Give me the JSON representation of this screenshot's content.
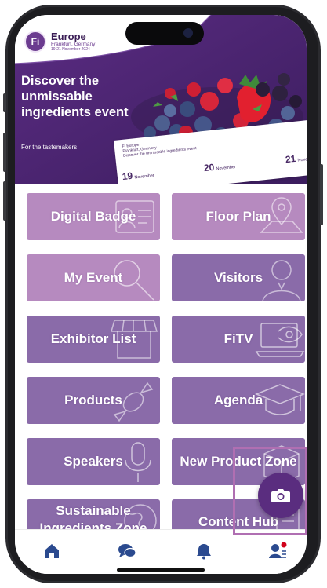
{
  "app": {
    "brand": {
      "logo_text": "Fi",
      "name": "Europe",
      "location": "Frankfurt, Germany",
      "dates": "19-21 November 2024"
    },
    "hero": {
      "headline": "Discover the unmissable ingredients event",
      "tagline": "For the tastemakers",
      "card": {
        "line1": "Fi Europe",
        "line2": "Frankfurt, Germany",
        "line3": "Discover the unmissable ingredients event"
      },
      "dates": [
        {
          "day": "19",
          "month": "November"
        },
        {
          "day": "20",
          "month": "November"
        },
        {
          "day": "21",
          "month": "November"
        }
      ]
    },
    "tiles": [
      {
        "label": "Digital Badge",
        "icon": "id-badge-icon"
      },
      {
        "label": "Floor Plan",
        "icon": "map-pin-icon"
      },
      {
        "label": "My Event",
        "icon": "magnifier-icon"
      },
      {
        "label": "Visitors",
        "icon": "person-icon"
      },
      {
        "label": "Exhibitor List",
        "icon": "storefront-icon"
      },
      {
        "label": "FiTV",
        "icon": "laptop-eye-icon"
      },
      {
        "label": "Products",
        "icon": "candy-icon"
      },
      {
        "label": "Agenda",
        "icon": "graduation-cap-icon"
      },
      {
        "label": "Speakers",
        "icon": "microphone-icon"
      },
      {
        "label": "New Product Zone",
        "icon": "box-icon"
      },
      {
        "label": "Sustainable Ingredients Zone",
        "icon": "globe-icon"
      },
      {
        "label": "Content Hub",
        "icon": "document-icon"
      }
    ],
    "fab": {
      "icon": "camera-icon"
    },
    "tabbar": [
      {
        "name": "home",
        "icon": "home-icon",
        "active": true
      },
      {
        "name": "chat",
        "icon": "chat-bubbles-icon"
      },
      {
        "name": "notifications",
        "icon": "bell-icon"
      },
      {
        "name": "profile",
        "icon": "profile-icon",
        "badge": true
      }
    ],
    "colors": {
      "primary": "#5a2d7f",
      "tile_pink": "#b68abf",
      "tile_violet": "#8a6ba9",
      "notification_dot": "#d0021b"
    }
  }
}
